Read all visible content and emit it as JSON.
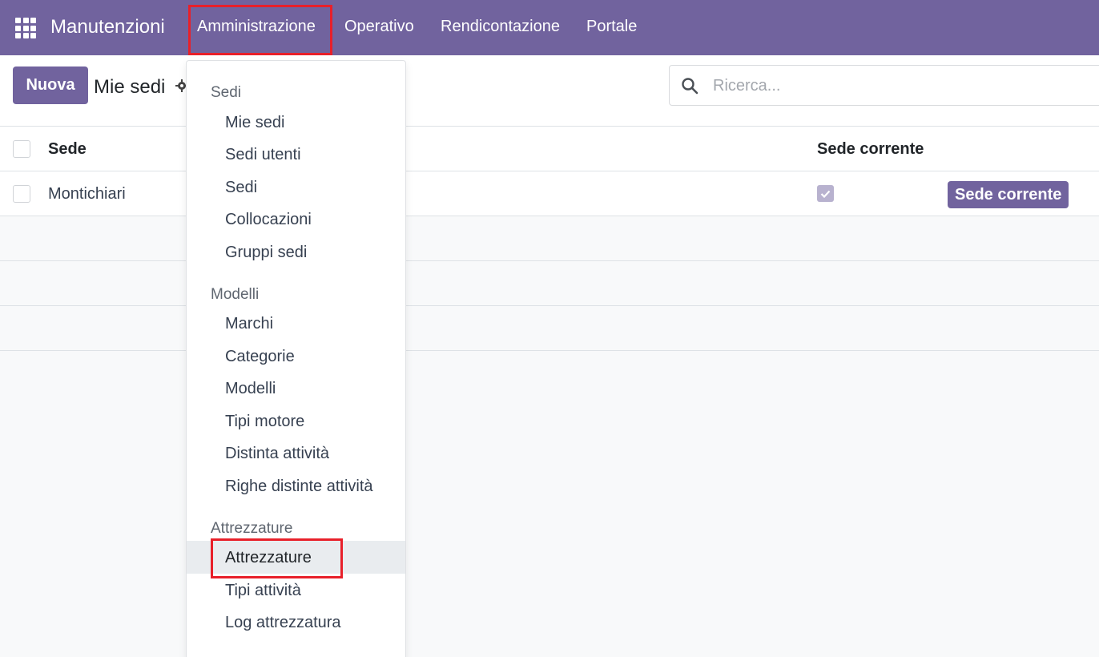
{
  "app": {
    "name": "Manutenzioni"
  },
  "nav": {
    "items": [
      {
        "label": "Amministrazione"
      },
      {
        "label": "Operativo"
      },
      {
        "label": "Rendicontazione"
      },
      {
        "label": "Portale"
      }
    ]
  },
  "control": {
    "new_label": "Nuova",
    "breadcrumb": "Mie sedi",
    "search_placeholder": "Ricerca..."
  },
  "table": {
    "columns": [
      "Sede",
      "Sede corrente"
    ],
    "rows": [
      {
        "sede": "Montichiari",
        "sede_corrente": true,
        "badge": "Sede corrente"
      }
    ]
  },
  "dropdown": {
    "sections": [
      {
        "title": "Sedi",
        "items": [
          "Mie sedi",
          "Sedi utenti",
          "Sedi",
          "Collocazioni",
          "Gruppi sedi"
        ]
      },
      {
        "title": "Modelli",
        "items": [
          "Marchi",
          "Categorie",
          "Modelli",
          "Tipi motore",
          "Distinta attività",
          "Righe distinte attività"
        ]
      },
      {
        "title": "Attrezzature",
        "items": [
          "Attrezzature",
          "Tipi attività",
          "Log attrezzatura"
        ]
      }
    ],
    "active_item": "Attrezzature"
  },
  "colors": {
    "brand": "#71639e",
    "highlight": "#e8202a"
  }
}
